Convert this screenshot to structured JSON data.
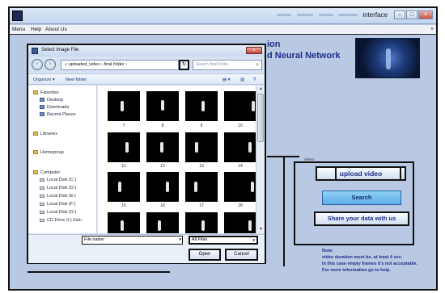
{
  "window": {
    "title": "interface",
    "min_glyph": "–",
    "max_glyph": "□",
    "close_glyph": "×"
  },
  "menu": {
    "items": [
      "Menu",
      "Help",
      "About Us"
    ],
    "expand_glyph": "»"
  },
  "header": {
    "title_line1": "ion",
    "title_line2": "d Neural Network"
  },
  "right_panel": {
    "title": "Select",
    "upload_label": "upload video",
    "search_label": "Search",
    "share_label": "Share your data with us"
  },
  "note": {
    "lines": [
      "Note:",
      "video duration must be, at least 4 sec.",
      "In this case empty frames it's not acceptable.",
      "For more information go to help."
    ]
  },
  "dialog": {
    "title": "Select Image File",
    "close_glyph": "×",
    "back_glyph": "‹",
    "forward_glyph": "›",
    "address": "« uploaded_video › final folder ›",
    "refresh_glyph": "↻",
    "search_placeholder": "Search final folder",
    "search_glyph": "⌕",
    "toolbar": {
      "organize": "Organize ▾",
      "new_folder": "New folder",
      "view_glyph": "▤ ▾",
      "pane_glyph": "▥",
      "help_glyph": "?"
    },
    "nav": [
      {
        "label": "Favorites",
        "kind": "head"
      },
      {
        "label": "Desktop",
        "kind": "sub"
      },
      {
        "label": "Downloads",
        "kind": "sub"
      },
      {
        "label": "Recent Places",
        "kind": "sub"
      },
      {
        "label": "Libraries",
        "kind": "head"
      },
      {
        "label": "Homegroup",
        "kind": "head"
      },
      {
        "label": "Computer",
        "kind": "head"
      },
      {
        "label": "Local Disk (C:)",
        "kind": "drive"
      },
      {
        "label": "Local Disk (D:)",
        "kind": "drive"
      },
      {
        "label": "Local Disk (E:)",
        "kind": "drive"
      },
      {
        "label": "Local Disk (F:)",
        "kind": "drive"
      },
      {
        "label": "Local Disk (G:)",
        "kind": "drive"
      },
      {
        "label": "CD Drive (I:) Zain",
        "kind": "drive"
      }
    ],
    "thumbnails": [
      {
        "label": "7"
      },
      {
        "label": "8"
      },
      {
        "label": "9"
      },
      {
        "label": "10"
      },
      {
        "label": "11"
      },
      {
        "label": "12"
      },
      {
        "label": "13"
      },
      {
        "label": "14"
      },
      {
        "label": "15"
      },
      {
        "label": "16"
      },
      {
        "label": "17"
      },
      {
        "label": "18"
      },
      {
        "label": ""
      },
      {
        "label": ""
      },
      {
        "label": ""
      },
      {
        "label": ""
      }
    ],
    "file_name_label": "File name:",
    "file_name_value": "",
    "file_type_value": "All Files",
    "open_label": "Open",
    "cancel_label": "Cancel"
  }
}
